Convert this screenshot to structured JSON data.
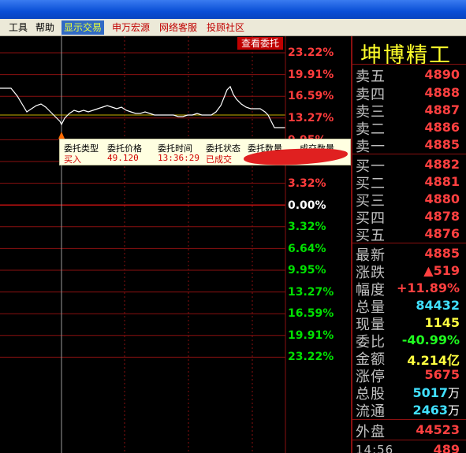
{
  "menu": {
    "items": [
      {
        "label": "工具",
        "style": "normal"
      },
      {
        "label": "帮助",
        "style": "normal"
      },
      {
        "label": "显示交易",
        "style": "active"
      },
      {
        "label": "申万宏源",
        "style": "red"
      },
      {
        "label": "网络客服",
        "style": "red"
      },
      {
        "label": "投顾社区",
        "style": "red"
      }
    ]
  },
  "chart": {
    "view_orders_button": "查看委托",
    "axis_labels": [
      "23.22%",
      "19.91%",
      "16.59%",
      "13.27%",
      "9.95%",
      "6.64%",
      "3.32%",
      "0.00%",
      "3.32%",
      "6.64%",
      "9.95%",
      "13.27%",
      "16.59%",
      "19.91%",
      "23.22%"
    ],
    "colors": {
      "up": "#ff3c3c",
      "down": "#00e000",
      "grid": "#8a1010",
      "price_line": "#ffffff",
      "avg_line": "#ffff00"
    }
  },
  "order_popup": {
    "headers": [
      "委托类型",
      "委托价格",
      "委托时间",
      "委托状态",
      "委托数量",
      "成交数量"
    ],
    "values": {
      "type": "买入",
      "price": "49.120",
      "time": "13:36:29",
      "status": "已成交"
    }
  },
  "quote": {
    "title": "坤博精工",
    "sell": [
      {
        "label": "卖五",
        "price": "4890"
      },
      {
        "label": "卖四",
        "price": "4888"
      },
      {
        "label": "卖三",
        "price": "4887"
      },
      {
        "label": "卖二",
        "price": "4886"
      },
      {
        "label": "卖一",
        "price": "4885"
      }
    ],
    "buy": [
      {
        "label": "买一",
        "price": "4882"
      },
      {
        "label": "买二",
        "price": "4881"
      },
      {
        "label": "买三",
        "price": "4880"
      },
      {
        "label": "买四",
        "price": "4878"
      },
      {
        "label": "买五",
        "price": "4876"
      }
    ],
    "latest": {
      "label": "最新",
      "value": "4885"
    },
    "change": {
      "label": "涨跌",
      "value": "▲519"
    },
    "pct_change": {
      "label": "幅度",
      "value": "+11.89%"
    },
    "total_volume": {
      "label": "总量",
      "value": "84432"
    },
    "current_volume": {
      "label": "现量",
      "value": "1145"
    },
    "order_ratio": {
      "label": "委比",
      "value": "-40.99%"
    },
    "amount": {
      "label": "金额",
      "value": "4.214亿"
    },
    "limit_up": {
      "label": "涨停",
      "value": "5675"
    },
    "total_shares": {
      "label": "总股",
      "value": "5017",
      "unit": "万"
    },
    "float_shares": {
      "label": "流通",
      "value": "2463",
      "unit": "万"
    },
    "outer_disk": {
      "label": "外盘",
      "value": "44523"
    },
    "time_row": {
      "time": "14:56",
      "price": "489"
    }
  }
}
